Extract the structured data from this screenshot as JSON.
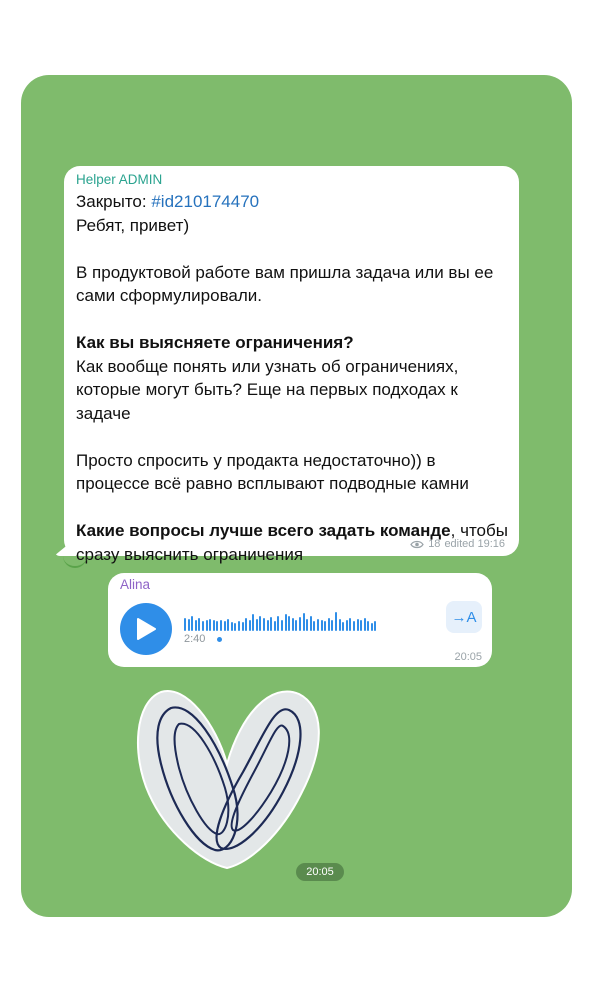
{
  "chat": {
    "background_color": "#7fbb6c",
    "message1": {
      "sender": "Helper ADMIN",
      "closed_label": "Закрыто: ",
      "hashtag": "#id210174470",
      "greeting": "Ребят, привет)",
      "para1": "В продуктовой работе вам пришла задача или вы ее сами сформулировали.",
      "question_bold": "Как вы выясняете ограничения?",
      "para2": "Как вообще понять или узнать об ограничениях, которые могут быть? Еще на первых подходах к задаче",
      "para3": "Просто спросить у продакта недостаточно)) в процессе всё равно всплывают подводные камни",
      "question2_bold": "Какие вопросы лучше всего задать команде",
      "question2_rest": ", чтобы сразу выяснить ограничения",
      "views": "18",
      "edited_time": "edited 19:16",
      "icon": "eye-icon"
    },
    "message2": {
      "sender": "Alina",
      "duration": "2:40",
      "transcribe_label": "→A",
      "time": "20:05",
      "icon": "play-icon",
      "waveform_levels": [
        0.6,
        0.55,
        0.7,
        0.5,
        0.6,
        0.45,
        0.5,
        0.55,
        0.5,
        0.45,
        0.5,
        0.45,
        0.55,
        0.4,
        0.35,
        0.45,
        0.4,
        0.6,
        0.5,
        0.75,
        0.55,
        0.7,
        0.6,
        0.5,
        0.65,
        0.45,
        0.7,
        0.5,
        0.75,
        0.7,
        0.6,
        0.5,
        0.65,
        0.8,
        0.55,
        0.7,
        0.45,
        0.55,
        0.5,
        0.45,
        0.6,
        0.5,
        0.85,
        0.55,
        0.4,
        0.5,
        0.6,
        0.45,
        0.55,
        0.5,
        0.6,
        0.45,
        0.35,
        0.45
      ]
    },
    "sticker": {
      "name": "paperclip-heart-sticker",
      "time": "20:05"
    }
  }
}
